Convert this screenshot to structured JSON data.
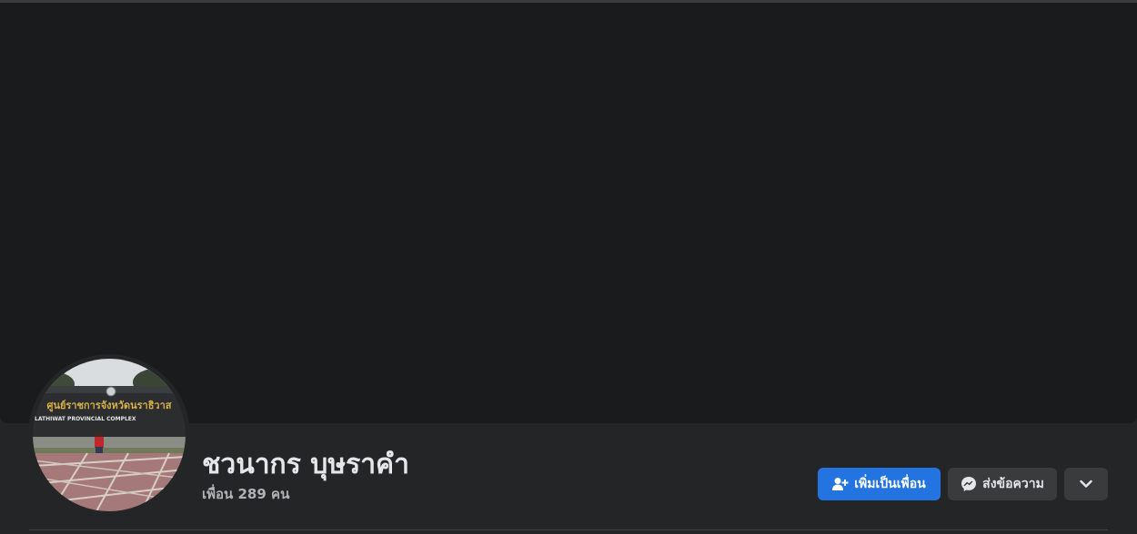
{
  "profile": {
    "name": "ชวนากร บุษราคำ",
    "friends_text": "เพื่อน 289 คน",
    "avatar_sign_thai": "ศูนย์ราชการจังหวัดนราธิวาส",
    "avatar_sign_english": "LATHIWAT PROVINCIAL COMPLEX"
  },
  "actions": {
    "add_friend_label": "เพิ่มเป็นเพื่อน",
    "message_label": "ส่งข้อความ"
  },
  "icons": {
    "add_friend": "person-add-icon",
    "message": "messenger-icon",
    "more": "chevron-down-icon"
  },
  "colors": {
    "background": "#242526",
    "cover": "#1a1b1d",
    "primary_button": "#2374e1",
    "secondary_button": "#3a3b3c",
    "text_primary": "#e4e6eb",
    "text_secondary": "#b0b3b8"
  }
}
